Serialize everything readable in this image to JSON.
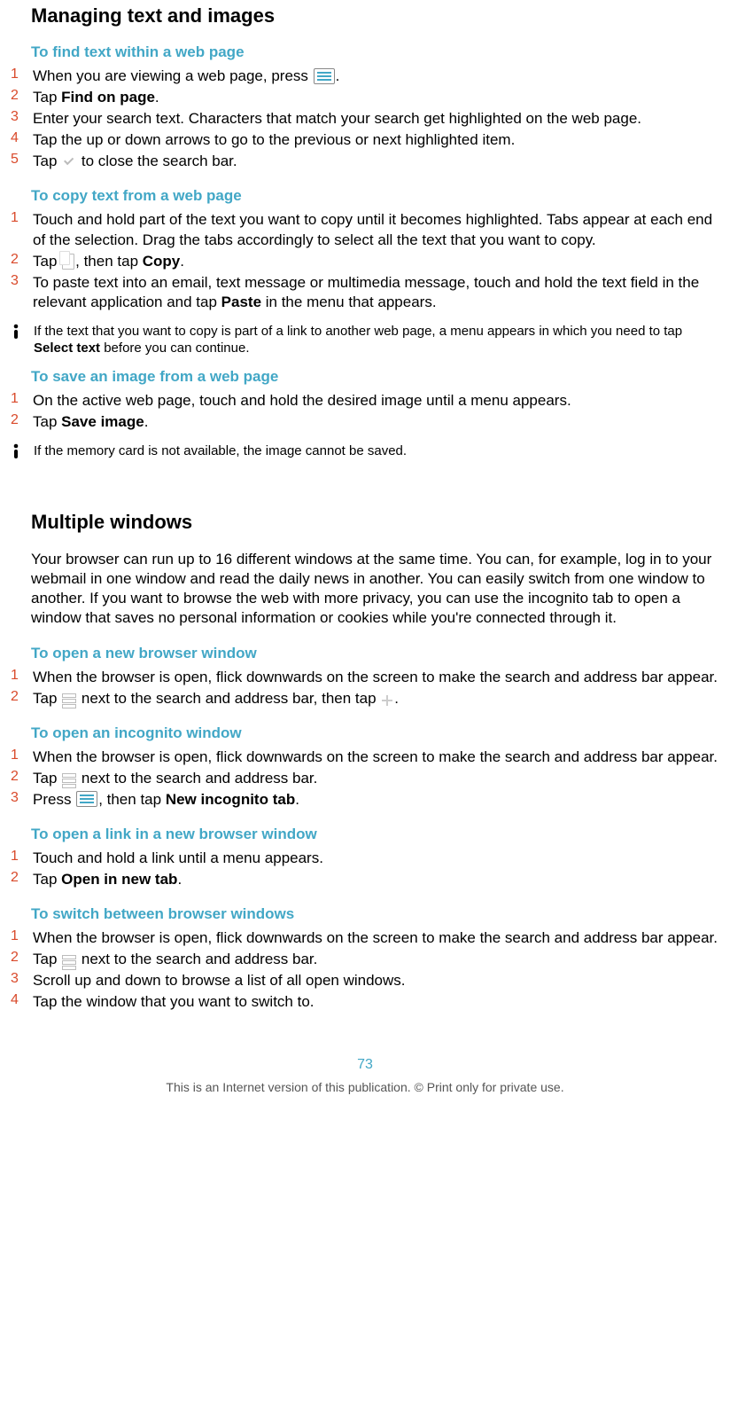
{
  "heading1": "Managing text and images",
  "find": {
    "title": "To find text within a web page",
    "steps": [
      {
        "pre": "When you are viewing a web page, press ",
        "icon": "menu",
        "post": "."
      },
      {
        "pre": "Tap ",
        "bold": "Find on page",
        "post": "."
      },
      {
        "pre": "Enter your search text. Characters that match your search get highlighted on the web page."
      },
      {
        "pre": "Tap the up or down arrows to go to the previous or next highlighted item."
      },
      {
        "pre": "Tap ",
        "icon": "check",
        "post": " to close the search bar."
      }
    ]
  },
  "copy": {
    "title": "To copy text from a web page",
    "steps": [
      {
        "pre": "Touch and hold part of the text you want to copy until it becomes highlighted. Tabs appear at each end of the selection. Drag the tabs accordingly to select all the text that you want to copy."
      },
      {
        "pre": "Tap ",
        "icon": "copy",
        "mid": ", then tap ",
        "bold": "Copy",
        "post": "."
      },
      {
        "pre": "To paste text into an email, text message or multimedia message, touch and hold the text field in the relevant application and tap ",
        "bold": "Paste",
        "post": " in the menu that appears."
      }
    ],
    "note_pre": "If the text that you want to copy is part of a link to another web page, a menu appears in which you need to tap ",
    "note_bold": "Select text",
    "note_post": " before you can continue."
  },
  "save": {
    "title": "To save an image from a web page",
    "steps": [
      {
        "pre": "On the active web page, touch and hold the desired image until a menu appears."
      },
      {
        "pre": "Tap ",
        "bold": "Save image",
        "post": "."
      }
    ],
    "note": "If the memory card is not available, the image cannot be saved."
  },
  "heading2": "Multiple windows",
  "multi_intro": "Your browser can run up to 16 different windows at the same time. You can, for example, log in to your webmail in one window and read the daily news in another. You can easily switch from one window to another. If you want to browse the web with more privacy, you can use the incognito tab to open a window that saves no personal information or cookies while you're connected through it.",
  "newwin": {
    "title": "To open a new browser window",
    "steps": [
      {
        "pre": "When the browser is open, flick downwards on the screen to make the search and address bar appear."
      },
      {
        "pre": "Tap ",
        "icon": "windows",
        "mid": " next to the search and address bar, then tap ",
        "icon2": "plus",
        "post": "."
      }
    ]
  },
  "incog": {
    "title": "To open an incognito window",
    "steps": [
      {
        "pre": "When the browser is open, flick downwards on the screen to make the search and address bar appear."
      },
      {
        "pre": "Tap ",
        "icon": "windows",
        "post": " next to the search and address bar."
      },
      {
        "pre": "Press ",
        "icon": "menu",
        "mid": ", then tap ",
        "bold": "New incognito tab",
        "post": "."
      }
    ]
  },
  "linknew": {
    "title": "To open a link in a new browser window",
    "steps": [
      {
        "pre": "Touch and hold a link until a menu appears."
      },
      {
        "pre": "Tap ",
        "bold": "Open in new tab",
        "post": "."
      }
    ]
  },
  "switch": {
    "title": "To switch between browser windows",
    "steps": [
      {
        "pre": "When the browser is open, flick downwards on the screen to make the search and address bar appear."
      },
      {
        "pre": "Tap ",
        "icon": "windows",
        "post": " next to the search and address bar."
      },
      {
        "pre": "Scroll up and down to browse a list of all open windows."
      },
      {
        "pre": "Tap the window that you want to switch to."
      }
    ]
  },
  "page_number": "73",
  "footer": "This is an Internet version of this publication. © Print only for private use."
}
